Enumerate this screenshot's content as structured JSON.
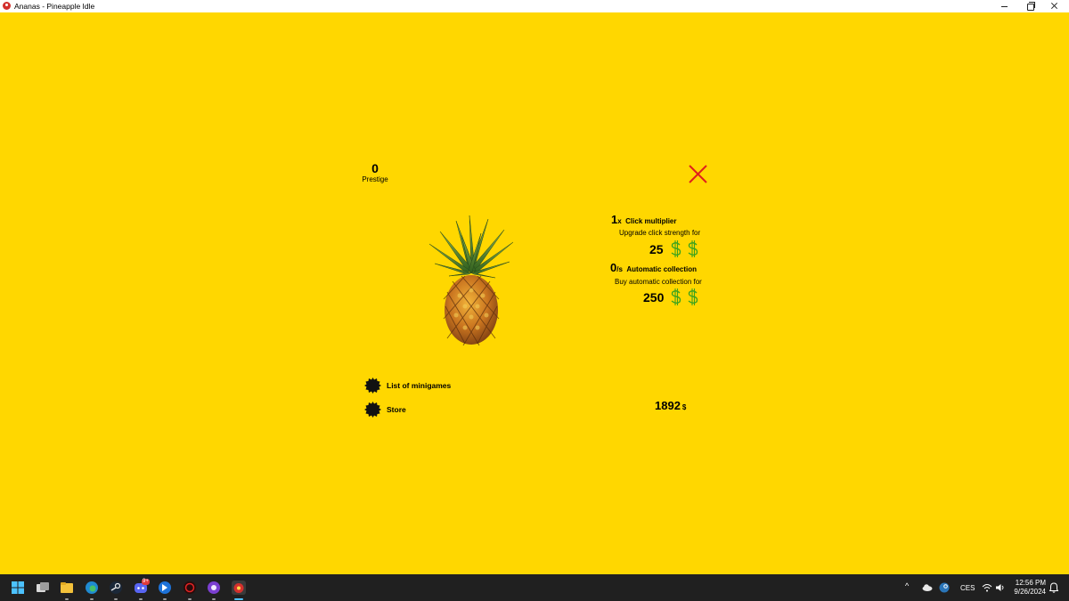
{
  "window": {
    "title": "Ananas - Pineapple Idle",
    "icon": "pineapple-app-icon"
  },
  "game": {
    "prestige": {
      "value": "0",
      "label": "Prestige"
    },
    "click_upgrade": {
      "level": "1",
      "suffix": "x",
      "title": "Click multiplier",
      "description": "Upgrade click strength for",
      "price": "25"
    },
    "auto_upgrade": {
      "level": "0",
      "suffix": "/s",
      "title": "Automatic collection",
      "description": "Buy automatic collection for",
      "price": "250"
    },
    "menu": [
      {
        "label": "List of minigames",
        "icon": "blob-icon"
      },
      {
        "label": "Store",
        "icon": "blob-icon"
      }
    ],
    "money": {
      "value": "1892",
      "unit": "$"
    },
    "colors": {
      "background": "#ffd700",
      "close": "#e0201c",
      "dollar": "#3ca31e"
    }
  },
  "taskbar": {
    "apps": [
      "windows-start",
      "task-view",
      "file-explorer",
      "edge",
      "steam",
      "discord",
      "app-blue",
      "app-red",
      "app-purple",
      "pineapple-idle"
    ],
    "discord_badge": "9+",
    "language": "CES",
    "time": "12:56 PM",
    "date": "9/26/2024"
  }
}
